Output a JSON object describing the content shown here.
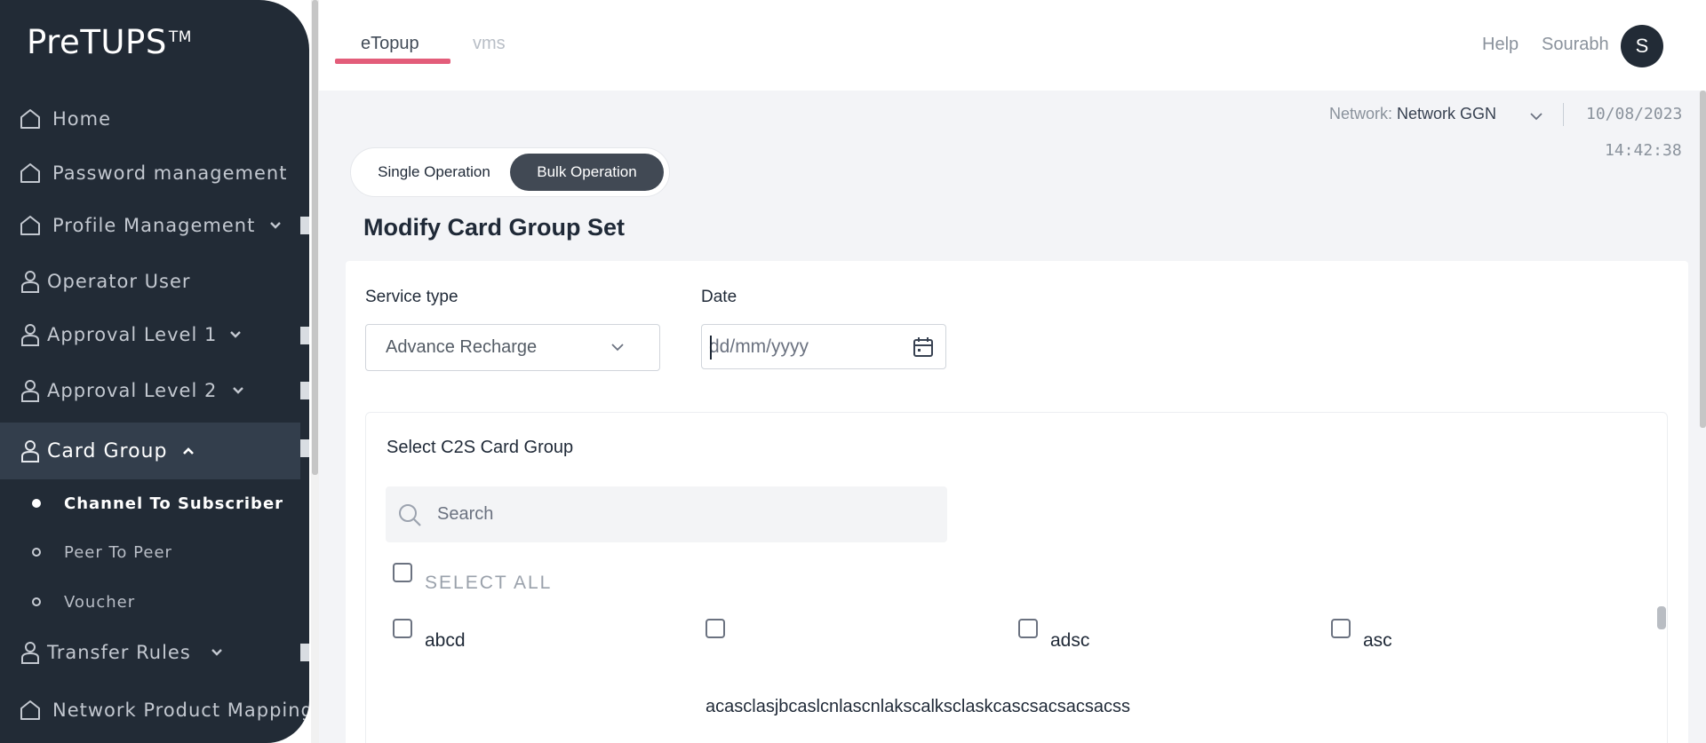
{
  "sidebar": {
    "brand": "PreTUPS",
    "brand_mark": "TM",
    "items": [
      {
        "label": "Home"
      },
      {
        "label": "Password management"
      },
      {
        "label": "Profile Management"
      },
      {
        "label": "Operator User"
      },
      {
        "label": "Approval Level 1"
      },
      {
        "label": "Approval Level 2"
      },
      {
        "label": "Card Group"
      },
      {
        "label": "Transfer Rules"
      },
      {
        "label": "Network Product Mapping"
      }
    ],
    "card_group_sub": [
      {
        "label": "Channel To Subscriber"
      },
      {
        "label": "Peer To Peer"
      },
      {
        "label": "Voucher"
      }
    ]
  },
  "header": {
    "tabs": [
      {
        "label": "eTopup"
      },
      {
        "label": "vms"
      }
    ],
    "help": "Help",
    "user_name": "Sourabh",
    "avatar_initial": "S"
  },
  "status": {
    "network_label": "Network:",
    "network_value": "Network GGN",
    "date": "10/08/2023",
    "time": "14:42:38"
  },
  "operation_toggle": {
    "single": "Single Operation",
    "bulk": "Bulk Operation"
  },
  "page_title": "Modify Card Group Set",
  "form": {
    "service_type_label": "Service type",
    "service_type_value": "Advance Recharge",
    "date_label": "Date",
    "date_placeholder": "dd/mm/yyyy"
  },
  "card_group_panel": {
    "title": "Select C2S Card Group",
    "search_placeholder": "Search",
    "select_all": "SELECT ALL",
    "options": [
      {
        "label": "abcd"
      },
      {
        "label": "acasclasjbcaslcnlascnlakscalksclaskcascsacsacsacss"
      },
      {
        "label": "adsc"
      },
      {
        "label": "asc"
      }
    ]
  },
  "colors": {
    "sidebar_bg": "#222b36",
    "accent_underline": "#e35d7a",
    "toggle_active": "#414954"
  }
}
